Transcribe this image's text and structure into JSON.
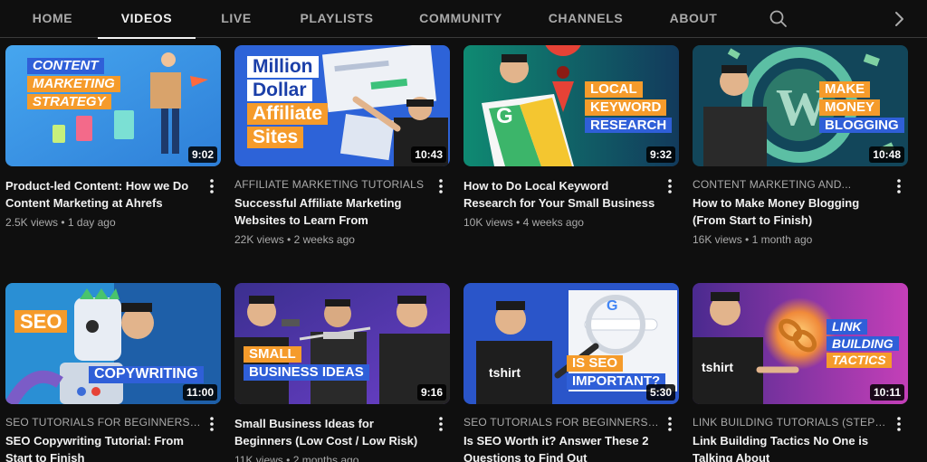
{
  "tabs": {
    "home": "HOME",
    "videos": "VIDEOS",
    "live": "LIVE",
    "playlists": "PLAYLISTS",
    "community": "COMMUNITY",
    "channels": "CHANNELS",
    "about": "ABOUT"
  },
  "icons": {
    "search": "search-icon",
    "next": "chevron-right-icon",
    "menu": "more-vert-icon"
  },
  "colors": {
    "background": "#0f0f0f",
    "text_primary": "#f1f1f1",
    "text_secondary": "#aaaaaa",
    "accent_orange": "#f59b2b",
    "accent_blue": "#2b5bd7"
  },
  "videos": [
    {
      "title": "Product-led Content: How we Do Content Marketing at Ahrefs",
      "category": "",
      "views": "2.5K views",
      "age": "1 day ago",
      "duration": "9:02",
      "thumb_text": [
        "CONTENT",
        "MARKETING",
        "STRATEGY"
      ]
    },
    {
      "title": "Successful Affiliate Marketing Websites to Learn From",
      "category": "AFFILIATE MARKETING TUTORIALS",
      "views": "22K views",
      "age": "2 weeks ago",
      "duration": "10:43",
      "thumb_text": [
        "Million",
        "Dollar",
        "Affiliate",
        "Sites"
      ]
    },
    {
      "title": "How to Do Local Keyword Research for Your Small Business",
      "category": "",
      "views": "10K views",
      "age": "4 weeks ago",
      "duration": "9:32",
      "thumb_text": [
        "LOCAL",
        "KEYWORD",
        "RESEARCH"
      ]
    },
    {
      "title": "How to Make Money Blogging (From Start to Finish)",
      "category": "CONTENT MARKETING AND...",
      "views": "16K views",
      "age": "1 month ago",
      "duration": "10:48",
      "thumb_text": [
        "MAKE",
        "MONEY",
        "BLOGGING"
      ]
    },
    {
      "title": "SEO Copywriting Tutorial: From Start to Finish",
      "category": "SEO TUTORIALS FOR BEGINNERS:...",
      "views": "",
      "age": "",
      "duration": "11:00",
      "thumb_text": [
        "SEO",
        "COPYWRITING"
      ]
    },
    {
      "title": "Small Business Ideas for Beginners (Low Cost / Low Risk)",
      "category": "",
      "views": "11K views",
      "age": "2 months ago",
      "duration": "9:16",
      "thumb_text": [
        "SMALL",
        "BUSINESS IDEAS"
      ]
    },
    {
      "title": "Is SEO Worth it? Answer These 2 Questions to Find Out",
      "category": "SEO TUTORIALS FOR BEGINNERS:...",
      "views": "",
      "age": "",
      "duration": "5:30",
      "thumb_text": [
        "IS SEO",
        "IMPORTANT?"
      ]
    },
    {
      "title": "Link Building Tactics No One is Talking About",
      "category": "LINK BUILDING TUTORIALS (STEP-BY...",
      "views": "",
      "age": "",
      "duration": "10:11",
      "thumb_text": [
        "LINK",
        "BUILDING",
        "TACTICS"
      ]
    }
  ]
}
